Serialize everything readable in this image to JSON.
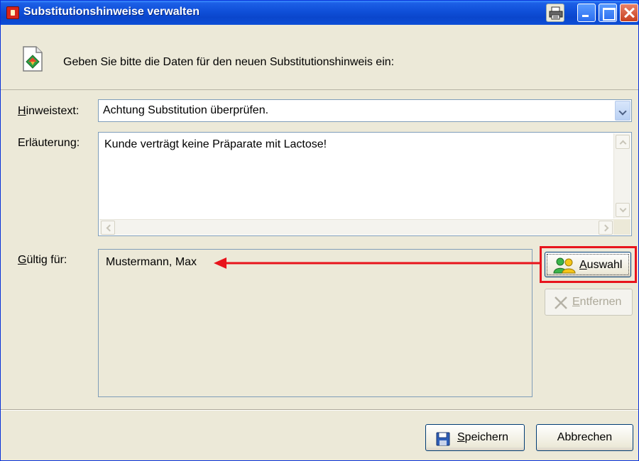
{
  "window": {
    "title": "Substitutionshinweise verwalten",
    "title_bar_buttons": [
      "print-icon",
      "minimize-icon",
      "maximize-icon",
      "close-icon"
    ],
    "accent_color": "#0a46cc"
  },
  "header": {
    "instruction": "Geben Sie bitte die Daten für den neuen Substitutionshinweis ein:",
    "icon": "edit-document-icon"
  },
  "form": {
    "hinweistext": {
      "label_first": "H",
      "label_rest": "inweistext:",
      "value": "Achtung Substitution überprüfen."
    },
    "erlaeuterung": {
      "label": "Erläuterung:",
      "value": "Kunde verträgt keine Präparate mit Lactose!"
    },
    "gueltig_fuer": {
      "label_first": "G",
      "label_rest": "ültig für:",
      "items": [
        "Mustermann, Max"
      ]
    }
  },
  "buttons": {
    "auswahl": {
      "label_first": "A",
      "label_rest": "uswahl",
      "icon": "users-icon"
    },
    "entfernen": {
      "label_first": "E",
      "label_rest": "ntfernen",
      "icon": "remove-x-icon",
      "enabled": false
    },
    "speichern": {
      "label_first": "S",
      "label_rest": "peichern",
      "icon": "floppy-disk-icon"
    },
    "abbrechen": {
      "label": "Abbrechen"
    }
  },
  "annotation": {
    "highlight_color": "#e8141c"
  }
}
